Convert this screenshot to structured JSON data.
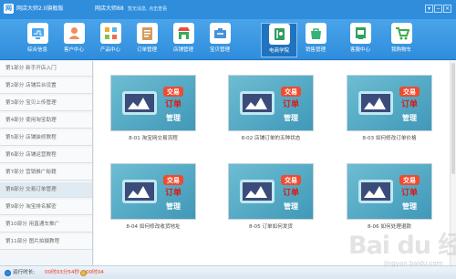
{
  "app": {
    "logo_text": "网",
    "title": "网店大师2.0旗舰版",
    "user": "网店大师88",
    "notice": "暂无消息, 点击查看"
  },
  "window_controls": [
    "▾",
    "−",
    "×"
  ],
  "toolbar": [
    {
      "label": "综合信息",
      "icon": "monitor-icon",
      "color": "#48a8ee"
    },
    {
      "label": "客户中心",
      "icon": "user-icon",
      "color": "#ef8f5d"
    },
    {
      "label": "产品中心",
      "icon": "grid-icon",
      "color": "#f2ac2e"
    },
    {
      "label": "订单管理",
      "icon": "clipboard-icon",
      "color": "#d59a59"
    },
    {
      "label": "店铺管理",
      "icon": "store-icon",
      "color": "#3aa957"
    },
    {
      "label": "宝贝管理",
      "icon": "tools-icon",
      "color": "#4a90d9"
    },
    {
      "label": "电商学院",
      "icon": "book-icon",
      "color": "#2f9c61",
      "active": true
    },
    {
      "label": "销售管理",
      "icon": "bag-icon",
      "color": "#37b178"
    },
    {
      "label": "客服中心",
      "icon": "headset-icon",
      "color": "#2ea35f"
    },
    {
      "label": "我购物车",
      "icon": "cart-icon",
      "color": "#41ac4c"
    }
  ],
  "sidebar": [
    "第1部分 新手开店入门",
    "第2部分 店铺后台设置",
    "第3部分 宝贝上传管理",
    "第4部分 使用淘宝助理",
    "第5部分 店铺装修教程",
    "第6部分 店铺运营教程",
    "第7部分 营销推广秘籍",
    "第8部分 交易订单管理",
    "第9部分 淘宝排名解密",
    "第10部分 用直通车推广",
    "第11部分 图片拍摄教程"
  ],
  "courses": [
    {
      "caption": "8-01 淘宝网交易流程",
      "title_top": "交易",
      "title_mid": "订单",
      "title_bottom": "管理"
    },
    {
      "caption": "8-02 店铺订单的五种状态",
      "title_top": "交易",
      "title_mid": "订单",
      "title_bottom": "管理"
    },
    {
      "caption": "8-03 如何修改订单价格",
      "title_top": "交易",
      "title_mid": "订单",
      "title_bottom": "管理"
    },
    {
      "caption": "8-04 如何修改收货地址",
      "title_top": "交易",
      "title_mid": "订单",
      "title_bottom": "管理"
    },
    {
      "caption": "8-05 订单如何发货",
      "title_top": "交易",
      "title_mid": "订单",
      "title_bottom": "管理"
    },
    {
      "caption": "8-06 如何处理退款",
      "title_top": "交易",
      "title_mid": "订单",
      "title_bottom": "管理"
    }
  ],
  "status": {
    "label": "运行时长:",
    "time_1": "00时03分54秒",
    "time_2": "00时04"
  },
  "watermark": {
    "logo": "Bai du 经验",
    "url": "jingyan.baidu.com"
  },
  "colors": {
    "brand": "#2f8ddc",
    "accent": "#e53a1d"
  }
}
